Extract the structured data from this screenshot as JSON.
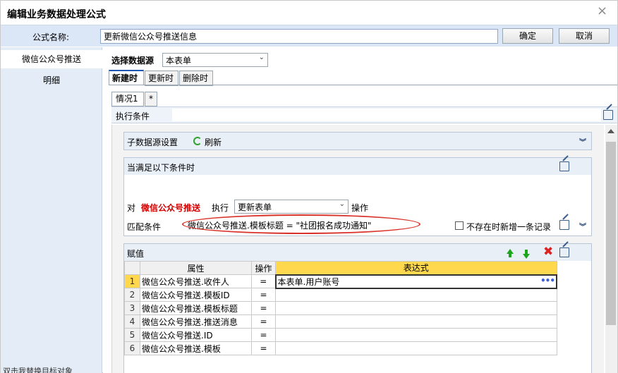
{
  "window": {
    "title": "编辑业务数据处理公式",
    "close_glyph": "×"
  },
  "formula": {
    "label": "公式名称:",
    "value": "更新微信公众号推送信息",
    "ok_label": "确定",
    "cancel_label": "取消"
  },
  "sidebar": {
    "items": [
      {
        "label": "微信公众号推送"
      },
      {
        "label": "明细"
      }
    ],
    "footer_text": "双击我替换目标对象"
  },
  "datasource": {
    "label": "选择数据源",
    "selected": "本表单"
  },
  "tabs": [
    {
      "label": "新建时"
    },
    {
      "label": "更新时"
    },
    {
      "label": "删除时"
    }
  ],
  "subtabs": [
    {
      "label": "情况1"
    },
    {
      "label": "*"
    }
  ],
  "exec_condition": {
    "label": "执行条件",
    "value": ""
  },
  "child_source": {
    "title": "子数据源设置",
    "refresh_label": "刷新"
  },
  "conditions": {
    "title": "当满足以下条件时",
    "for_label": "对",
    "target": "微信公众号推送",
    "exec_label": "执行",
    "action_selected": "更新表单",
    "operate_label": "操作",
    "match_label": "匹配条件",
    "match_value": "微信公众号推送.模板标题 = \"社团报名成功通知\"",
    "no_exist_label": "不存在时新增一条记录"
  },
  "assign": {
    "title": "赋值",
    "columns": [
      "属性",
      "操作",
      "表达式"
    ],
    "rows": [
      {
        "num": "1",
        "attr": "微信公众号推送.收件人",
        "op": "=",
        "expr": "本表单.用户账号"
      },
      {
        "num": "2",
        "attr": "微信公众号推送.模板ID",
        "op": "=",
        "expr": ""
      },
      {
        "num": "3",
        "attr": "微信公众号推送.模板标题",
        "op": "=",
        "expr": ""
      },
      {
        "num": "4",
        "attr": "微信公众号推送.推送消息",
        "op": "=",
        "expr": ""
      },
      {
        "num": "5",
        "attr": "微信公众号推送.ID",
        "op": "=",
        "expr": ""
      },
      {
        "num": "6",
        "attr": "微信公众号推送.模板",
        "op": "=",
        "expr": ""
      }
    ],
    "expr_more": "•••"
  },
  "colors": {
    "accent": "#1f57b5",
    "highlight": "#ffd84d",
    "red": "#d40000",
    "green": "#1ea51e",
    "panel": "#e9eff7"
  }
}
